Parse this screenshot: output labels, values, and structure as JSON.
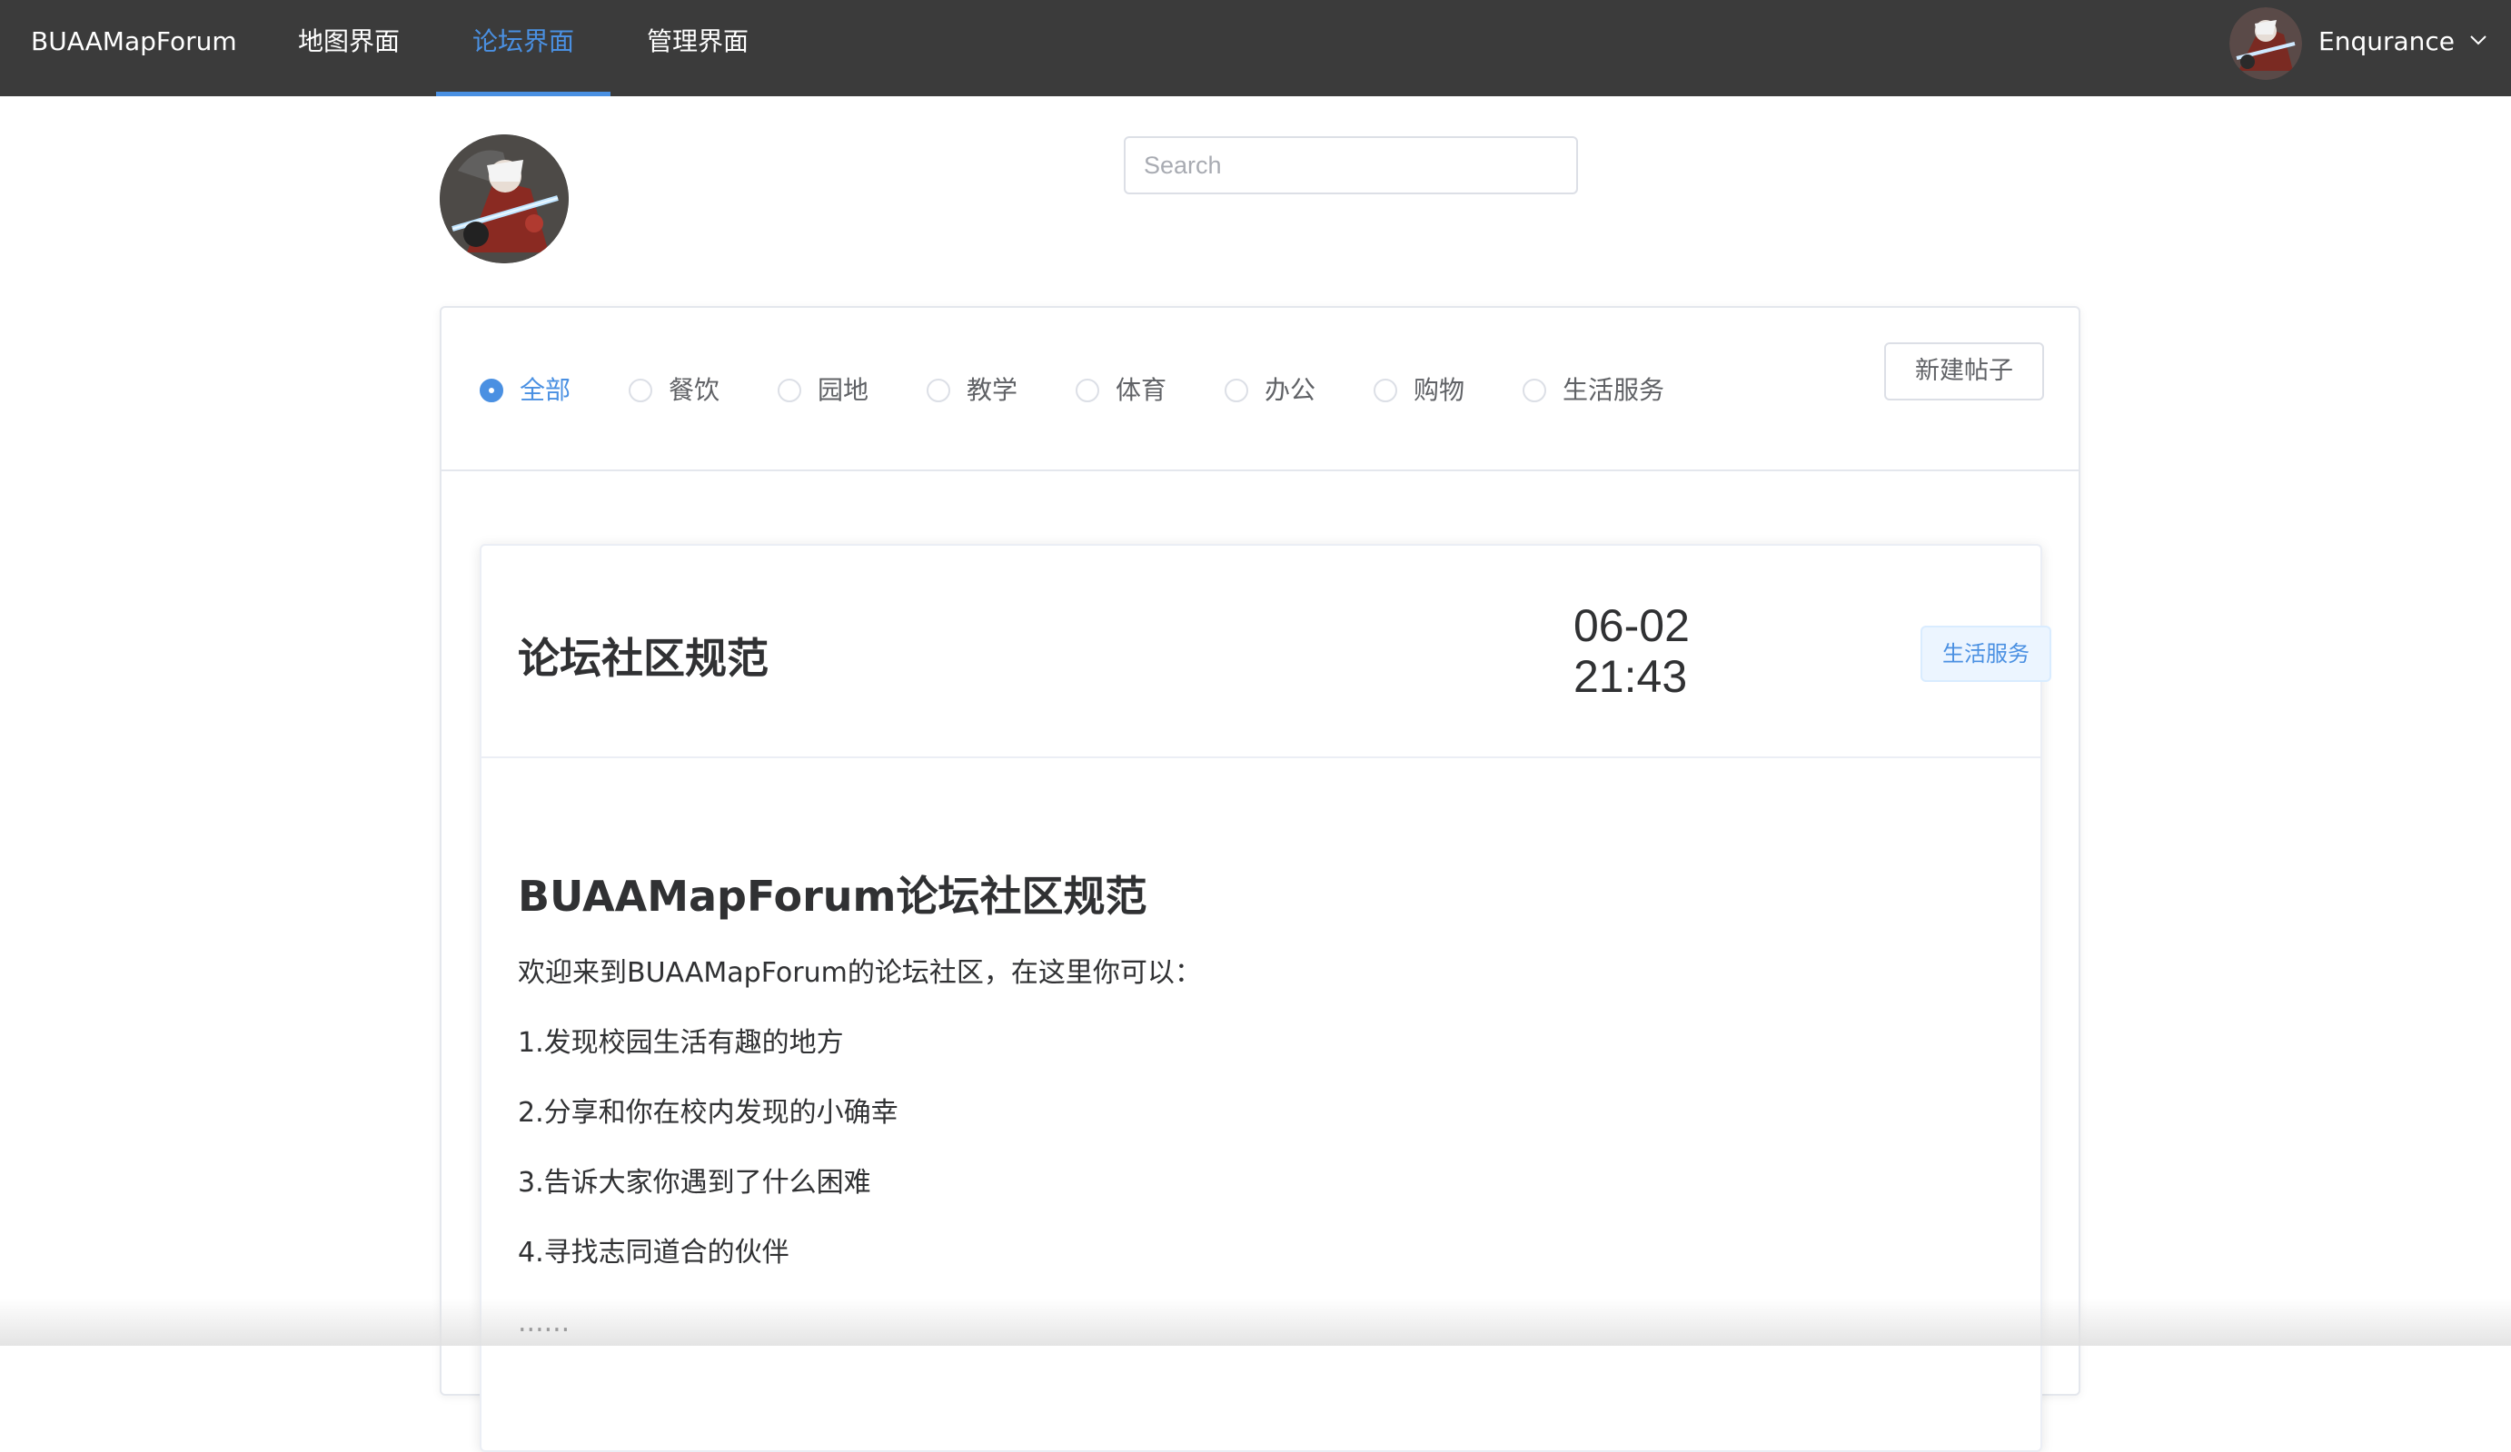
{
  "nav": {
    "brand": "BUAAMapForum",
    "items": [
      {
        "label": "地图界面",
        "active": false
      },
      {
        "label": "论坛界面",
        "active": true
      },
      {
        "label": "管理界面",
        "active": false
      }
    ],
    "user": {
      "name": "Enqurance"
    },
    "active_color": "#4a90e2"
  },
  "search": {
    "placeholder": "Search",
    "value": ""
  },
  "filters": {
    "options": [
      "全部",
      "餐饮",
      "园地",
      "教学",
      "体育",
      "办公",
      "购物",
      "生活服务"
    ],
    "selected": "全部",
    "new_post_label": "新建帖子"
  },
  "post": {
    "title": "论坛社区规范",
    "date": "06-02",
    "time": "21:43",
    "tag": "生活服务",
    "body": {
      "heading": "BUAAMapForum论坛社区规范",
      "paragraphs": [
        "欢迎来到BUAAMapForum的论坛社区，在这里你可以：",
        "1.发现校园生活有趣的地方",
        "2.分享和你在校内发现的小确幸",
        "3.告诉大家你遇到了什么困难",
        "4.寻找志同道合的伙伴",
        "......"
      ]
    }
  }
}
